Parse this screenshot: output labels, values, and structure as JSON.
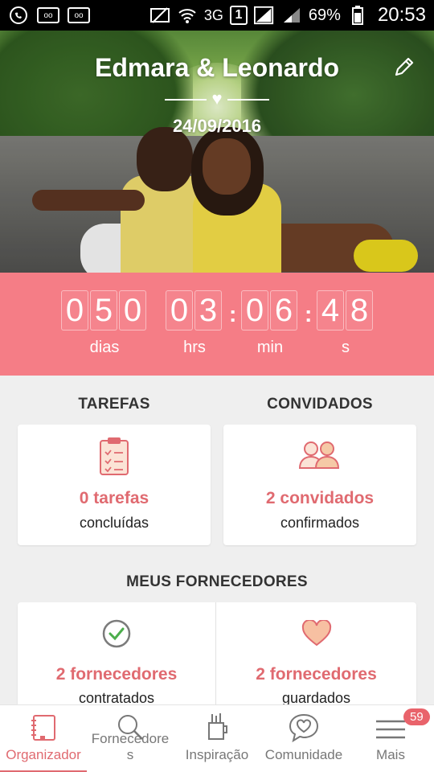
{
  "statusbar": {
    "battery": "69%",
    "time": "20:53",
    "network": "3G",
    "sim": "1"
  },
  "hero": {
    "title": "Edmara & Leonardo",
    "date": "24/09/2016"
  },
  "countdown": {
    "days": [
      "0",
      "5",
      "0"
    ],
    "hours": [
      "0",
      "3"
    ],
    "minutes": [
      "0",
      "6"
    ],
    "seconds": [
      "4",
      "8"
    ],
    "labels": {
      "days": "dias",
      "hours": "hrs",
      "minutes": "min",
      "seconds": "s"
    }
  },
  "sections": {
    "tasks": {
      "title": "TAREFAS",
      "main": "0 tarefas",
      "sub": "concluídas"
    },
    "guests": {
      "title": "CONVIDADOS",
      "main": "2 convidados",
      "sub": "confirmados"
    },
    "vendors_title": "MEUS FORNECEDORES",
    "vendors_hired": {
      "main": "2 fornecedores",
      "sub": "contratados"
    },
    "vendors_saved": {
      "main": "2 fornecedores",
      "sub": "guardados"
    }
  },
  "bottomnav": {
    "items": [
      {
        "label": "Organizador",
        "icon": "notebook-icon"
      },
      {
        "label": "Fornecedores",
        "icon": "search-icon"
      },
      {
        "label": "Inspiração",
        "icon": "art-supplies-icon"
      },
      {
        "label": "Comunidade",
        "icon": "chat-heart-icon"
      },
      {
        "label": "Mais",
        "icon": "menu-icon"
      }
    ],
    "badge": "59"
  },
  "colors": {
    "accent": "#f57d86",
    "accent_text": "#e06a70",
    "background": "#efefef"
  }
}
